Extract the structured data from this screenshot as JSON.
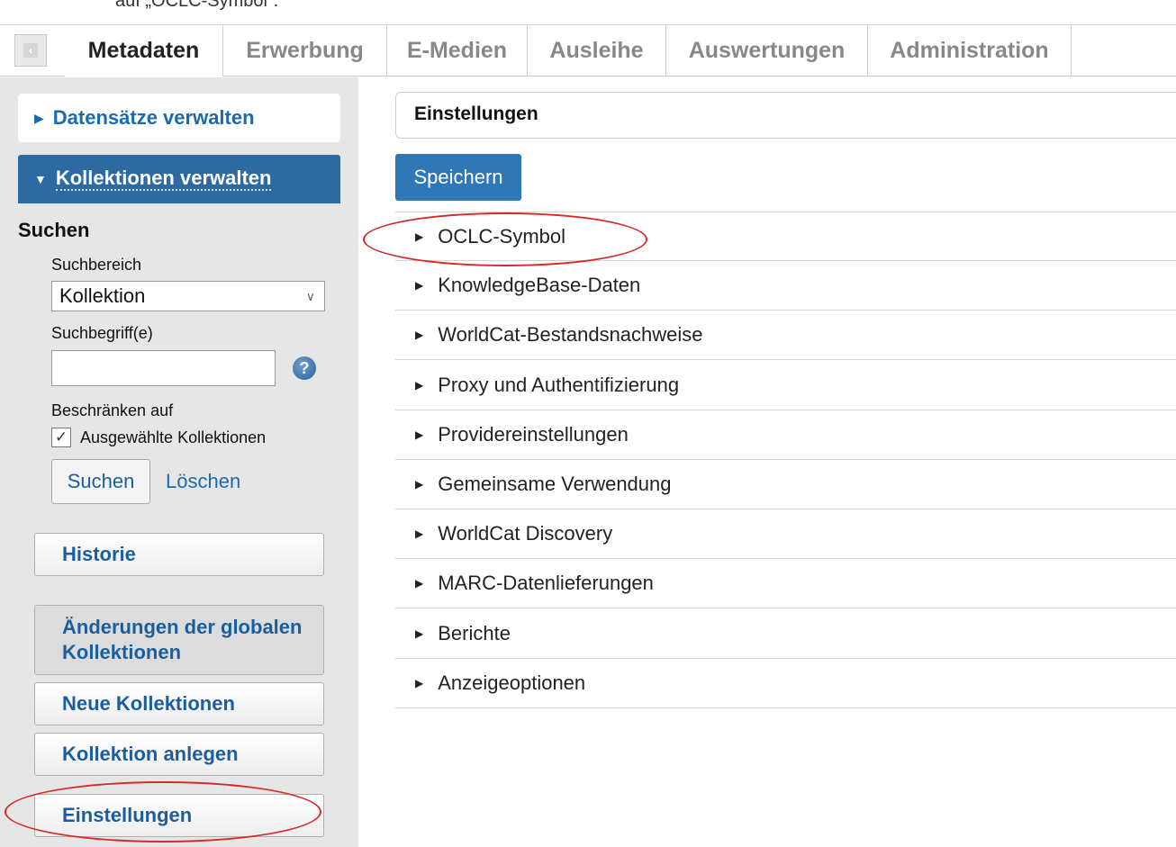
{
  "caption": "auf „OCLC-Symbol“.",
  "tabs": [
    {
      "label": "Metadaten",
      "active": true
    },
    {
      "label": "Erwerbung",
      "active": false
    },
    {
      "label": "E-Medien",
      "active": false
    },
    {
      "label": "Ausleihe",
      "active": false
    },
    {
      "label": "Auswertungen",
      "active": false
    },
    {
      "label": "Administration",
      "active": false
    }
  ],
  "sidebar": {
    "datasets": "Datensätze verwalten",
    "collections": "Kollektionen verwalten",
    "search_heading": "Suchen",
    "search_area_label": "Suchbereich",
    "search_area_value": "Kollektion",
    "search_terms_label": "Suchbegriff(e)",
    "search_terms_value": "",
    "limit_label": "Beschränken auf",
    "limit_option": "Ausgewählte Kollektionen",
    "limit_checked": true,
    "search_button": "Suchen",
    "clear_link": "Löschen",
    "history": "Historie",
    "global_changes": "Änderungen der globalen Kollektionen",
    "new_collections": "Neue Kollektionen",
    "create_collection": "Kollektion anlegen",
    "settings": "Einstellungen"
  },
  "main": {
    "heading": "Einstellungen",
    "save_button": "Speichern",
    "panels": [
      "OCLC-Symbol",
      "KnowledgeBase-Daten",
      "WorldCat-Bestandsnachweise",
      "Proxy und Authentifizierung",
      "Providereinstellungen",
      "Gemeinsame Verwendung",
      "WorldCat Discovery",
      "MARC-Datenlieferungen",
      "Berichte",
      "Anzeigeoptionen"
    ]
  },
  "colors": {
    "accent": "#2d6aa2",
    "link": "#1b6ab0",
    "annotation": "#d42a2a"
  }
}
